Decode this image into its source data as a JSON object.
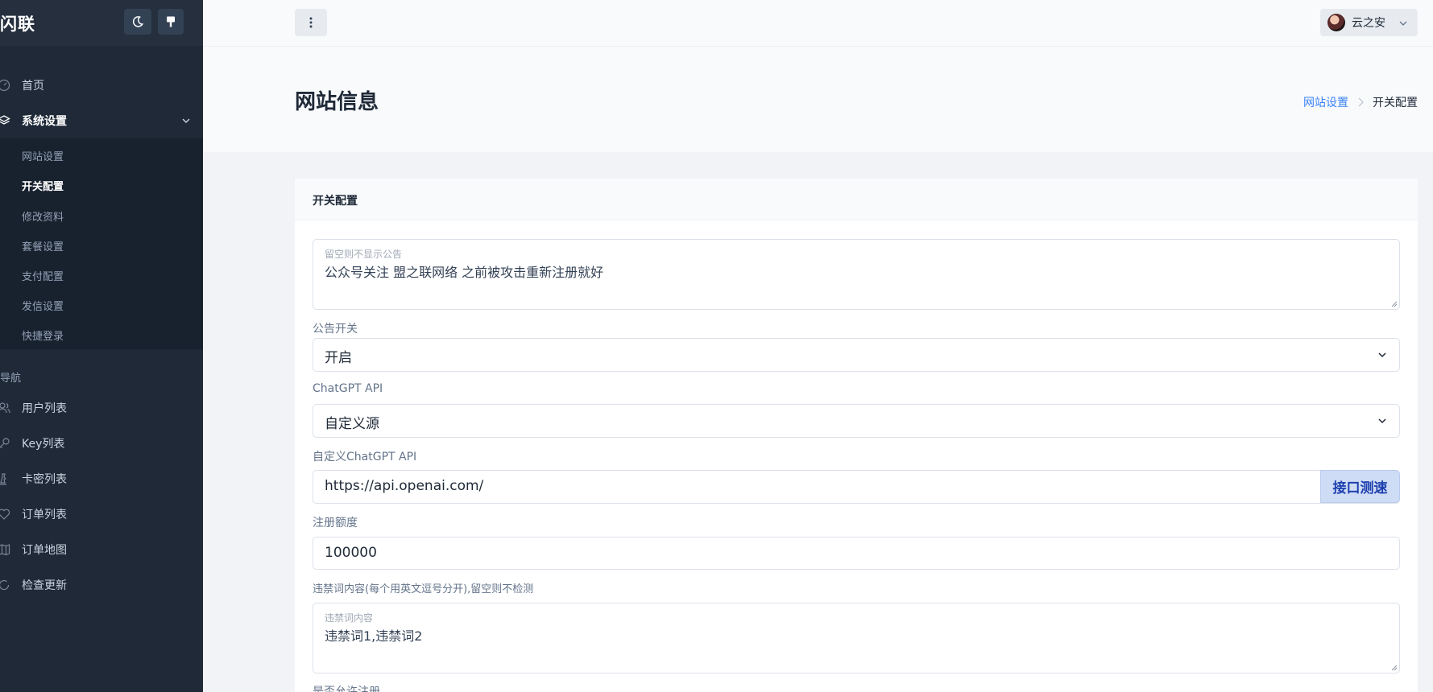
{
  "sidebar": {
    "brand": "闪联",
    "nav": [
      {
        "label": "首页",
        "icon": "gauge-icon"
      },
      {
        "label": "系统设置",
        "icon": "layers-icon"
      },
      {
        "label": "用户列表",
        "icon": "users-icon"
      },
      {
        "label": "Key列表",
        "icon": "key-icon"
      },
      {
        "label": "卡密列表",
        "icon": "chess-piece-icon"
      },
      {
        "label": "订单列表",
        "icon": "heart-icon"
      },
      {
        "label": "订单地图",
        "icon": "map-icon"
      },
      {
        "label": "检查更新",
        "icon": "refresh-icon"
      }
    ],
    "submenu": [
      "网站设置",
      "开关配置",
      "修改资料",
      "套餐设置",
      "支付配置",
      "发信设置",
      "快捷登录"
    ],
    "section_heading": "导航"
  },
  "topbar": {
    "user_name": "云之安"
  },
  "header": {
    "title": "网站信息",
    "breadcrumb": {
      "parent": "网站设置",
      "current": "开关配置"
    }
  },
  "card": {
    "title": "开关配置",
    "announcement": {
      "placeholder": "留空则不显示公告",
      "value": "公众号关注 盟之联网络 之前被攻击重新注册就好"
    },
    "announcement_switch": {
      "label": "公告开关",
      "value": "开启"
    },
    "chatgpt_api": {
      "label": "ChatGPT API",
      "value": "自定义源"
    },
    "custom_api": {
      "label": "自定义ChatGPT API",
      "value": "https://api.openai.com/",
      "button": "接口测速"
    },
    "register_quota": {
      "label": "注册额度",
      "value": "100000"
    },
    "banned_words": {
      "label": "违禁词内容(每个用英文逗号分开),留空则不检测",
      "placeholder": "违禁词内容",
      "value": "违禁词1,违禁词2"
    },
    "allow_register": {
      "label": "是否允许注册"
    }
  }
}
